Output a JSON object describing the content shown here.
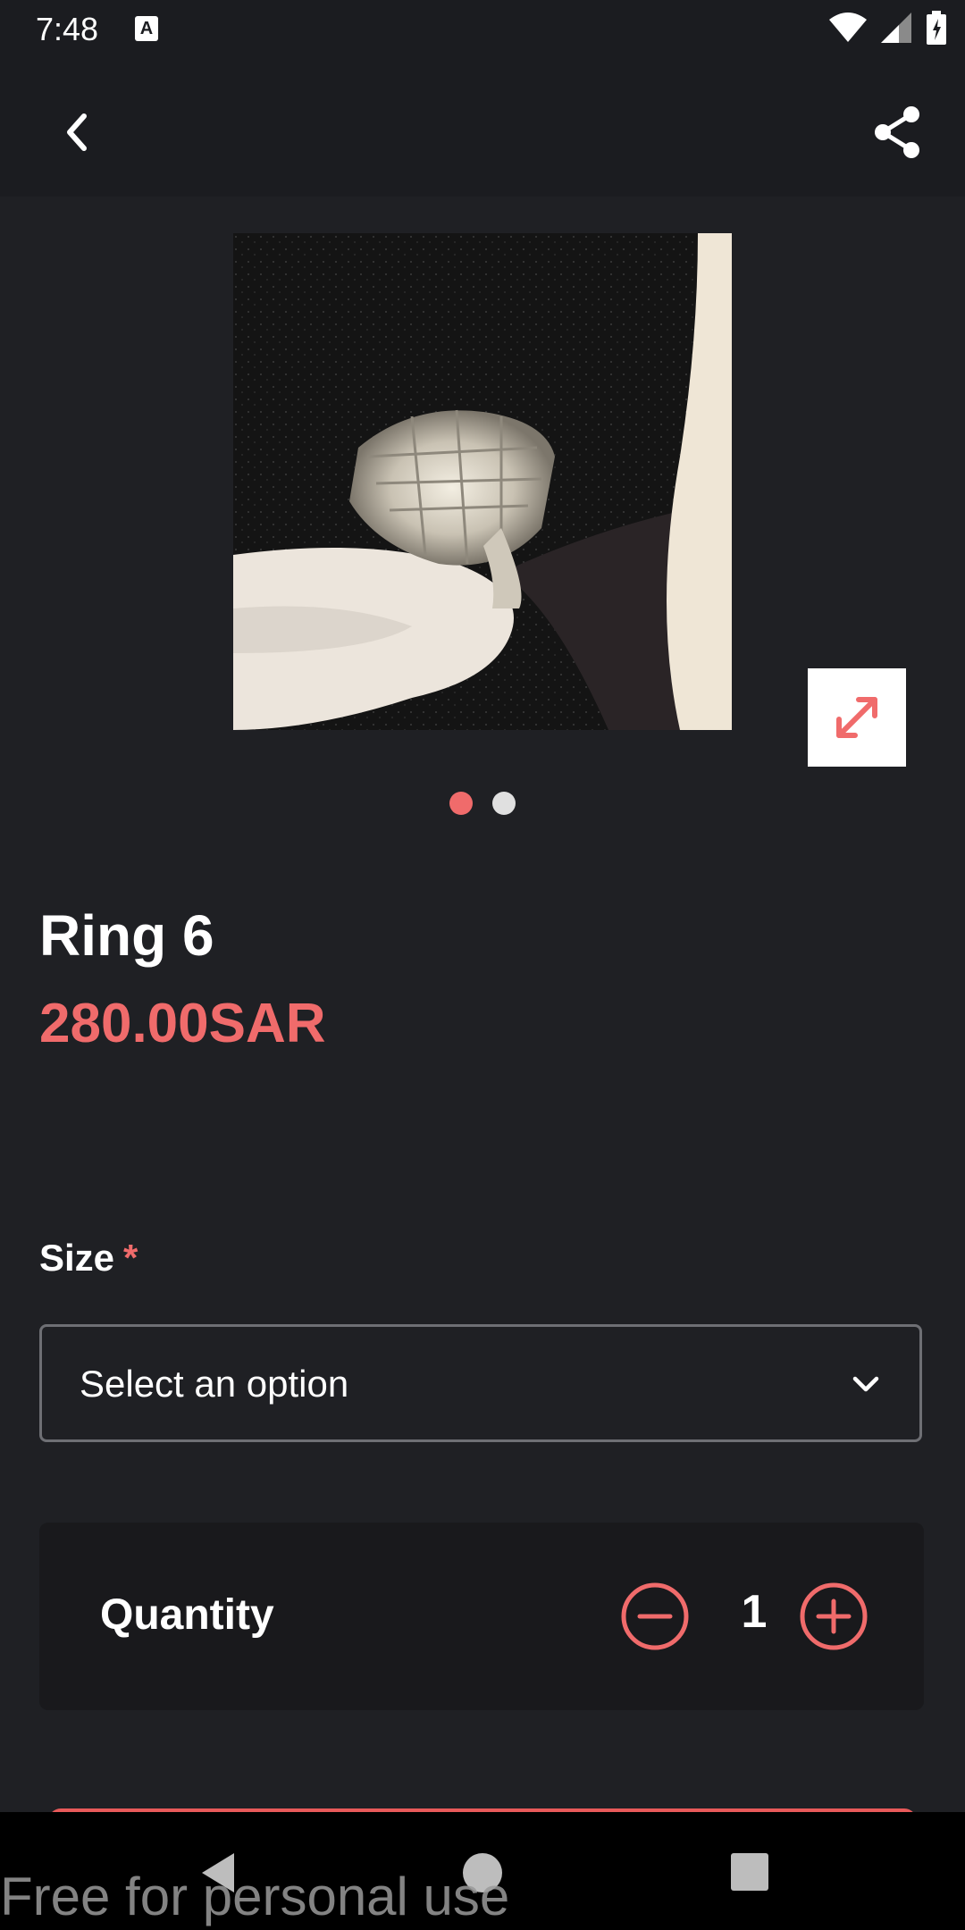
{
  "status_bar": {
    "time": "7:48",
    "notification_icon": "A"
  },
  "header": {
    "back_icon": "chevron-left-icon",
    "share_icon": "share-icon"
  },
  "gallery": {
    "slide_count": 2,
    "active_index": 0,
    "zoom_icon": "expand-icon"
  },
  "product": {
    "title": "Ring 6",
    "price": "280.00SAR"
  },
  "size": {
    "label": "Size",
    "required_mark": "*",
    "select_value": "Select an option"
  },
  "quantity": {
    "label": "Quantity",
    "value": "1"
  },
  "watermark": "Free for personal use",
  "colors": {
    "accent": "#f06b6b",
    "background": "#1f2024",
    "card": "#19191c"
  }
}
